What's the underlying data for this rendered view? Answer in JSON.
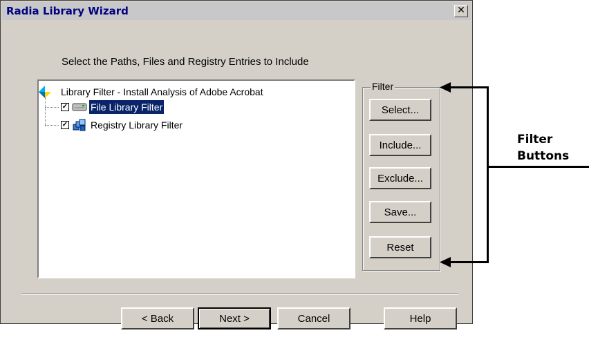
{
  "window": {
    "title": "Radia Library Wizard",
    "close_glyph": "✕"
  },
  "instruction": "Select the Paths, Files and Registry Entries to Include",
  "tree": {
    "root": {
      "label": "Library Filter - Install Analysis of Adobe Acrobat",
      "icon": "library-filter-icon"
    },
    "items": [
      {
        "label": "File Library Filter",
        "checked": true,
        "selected": true,
        "icon": "drive-icon"
      },
      {
        "label": "Registry Library Filter",
        "checked": true,
        "selected": false,
        "icon": "registry-icon"
      }
    ]
  },
  "filter": {
    "legend": "Filter",
    "buttons": [
      "Select...",
      "Include...",
      "Exclude...",
      "Save...",
      "Reset"
    ]
  },
  "nav": {
    "back": "< Back",
    "next": "Next >",
    "cancel": "Cancel",
    "help": "Help"
  },
  "annotation": {
    "line1": "Filter",
    "line2": "Buttons"
  },
  "colors": {
    "dialog_bg": "#d4d0c8",
    "title_text": "#000080",
    "selection": "#0a246a"
  }
}
